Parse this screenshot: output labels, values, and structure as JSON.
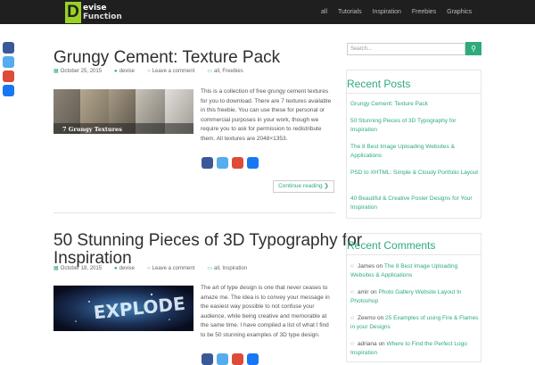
{
  "header": {
    "logo_letter": "D",
    "logo_line1": "evise",
    "logo_line2": "Function",
    "nav": [
      "all",
      "Tutorials",
      "Inspiration",
      "Freebies",
      "Graphics"
    ]
  },
  "colors": {
    "accent": "#2eab7b",
    "logo_green": "#9bd125",
    "facebook": "#3b5998",
    "twitter": "#55acee",
    "google": "#dd4b39",
    "delicious": "#1877f2"
  },
  "posts": [
    {
      "title": "Grungy Cement: Texture Pack",
      "date": "October 25, 2015",
      "author": "devise",
      "comments": "Leave a comment",
      "categories": "all, Freebies",
      "thumb_caption": "7 Grungy Textures",
      "excerpt": "This is a collection of free grungy cement textures for you to download. There are 7 textures available in this freebie. You can use these for personal or commercial purposes in your work, though we require you to ask for permission to redistribute them. All textures are 2048×1353.",
      "continue": "Continue reading ❯"
    },
    {
      "title_line1": "50 Stunning Pieces of 3D Typography for",
      "title_line2": "Inspiration",
      "date": "October 18, 2015",
      "author": "devise",
      "comments": "Leave a comment",
      "categories": "all, Inspiration",
      "thumb_caption": "EXPLODE",
      "excerpt": "The art of type design is one that never ceases to amaze me. The idea is to convey your message in the easiest way possible to not confuse your audience, while being creative and memorable at the same time. I have compiled a list of what I find to be 50 stunning examples of 3D type design."
    }
  ],
  "sidebar": {
    "search_placeholder": "Search...",
    "recent_posts_title": "Recent Posts",
    "recent_posts": [
      "Grungy Cement: Texture Pack",
      "50 Stunning Pieces of 3D Typography for Inspiration",
      "The 8 Best Image Uploading Websites & Applications",
      "PSD to XHTML: Simple & Cloudy Portfolio Layout",
      "40 Beautiful & Creative Poster Designs for Your Inspiration"
    ],
    "recent_comments_title": "Recent Comments",
    "recent_comments": [
      {
        "author": "James",
        "on": "on",
        "post": "The 8 Best Image Uploading Websites & Applications"
      },
      {
        "author": "amir",
        "on": "on",
        "post": "Photo Gallery Website Layout In Photoshop"
      },
      {
        "author": "Zeemo",
        "on": "on",
        "post": "25 Examples of using Fire & Flames in your Designs"
      },
      {
        "author": "adriana",
        "on": "on",
        "post": "Where to Find the Perfect Logo Inspiration"
      }
    ]
  }
}
